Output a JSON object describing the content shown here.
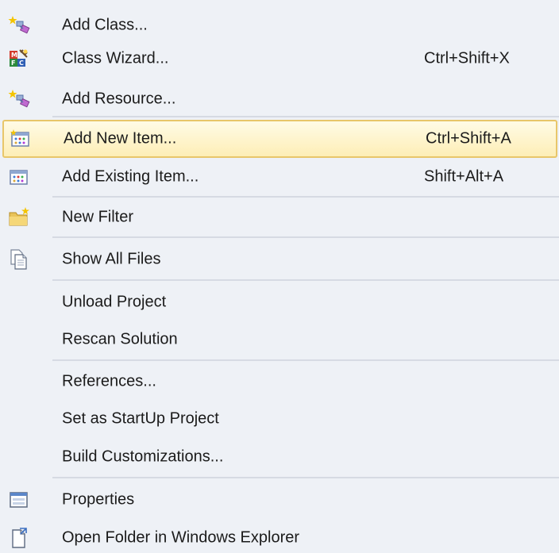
{
  "menu": {
    "items": [
      {
        "label": "Add Class...",
        "shortcut": "",
        "icon": "add-class-icon"
      },
      {
        "label": "Class Wizard...",
        "shortcut": "Ctrl+Shift+X",
        "icon": "mfc-class-wizard-icon"
      },
      {
        "label": "Add Resource...",
        "shortcut": "",
        "icon": "add-resource-icon"
      },
      {
        "label": "Add New Item...",
        "shortcut": "Ctrl+Shift+A",
        "icon": "add-new-item-icon",
        "highlighted": true
      },
      {
        "label": "Add Existing Item...",
        "shortcut": "Shift+Alt+A",
        "icon": "add-existing-item-icon"
      },
      {
        "label": "New Filter",
        "shortcut": "",
        "icon": "new-folder-icon"
      },
      {
        "label": "Show All Files",
        "shortcut": "",
        "icon": "show-all-files-icon"
      },
      {
        "label": "Unload Project",
        "shortcut": ""
      },
      {
        "label": "Rescan Solution",
        "shortcut": ""
      },
      {
        "label": "References...",
        "shortcut": ""
      },
      {
        "label": "Set as StartUp Project",
        "shortcut": ""
      },
      {
        "label": "Build Customizations...",
        "shortcut": ""
      },
      {
        "label": "Properties",
        "shortcut": "",
        "icon": "properties-icon"
      },
      {
        "label": "Open Folder in Windows Explorer",
        "shortcut": "",
        "icon": "open-folder-icon"
      }
    ]
  },
  "colors": {
    "background": "#eef1f6",
    "highlight_top": "#fffbe6",
    "highlight_bottom": "#fdeeb6",
    "highlight_border": "#e8c66a",
    "separator": "#d6dae3"
  }
}
